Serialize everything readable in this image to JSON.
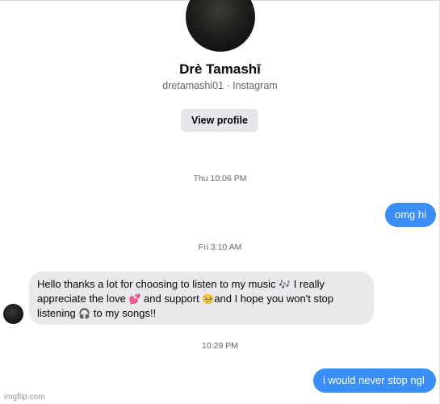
{
  "profile": {
    "name": "Drè Tamashī",
    "handle_line": "dretamashi01 · Instagram",
    "view_profile_label": "View profile"
  },
  "timestamps": [
    "Thu 10:06 PM",
    "Fri 3:10 AM",
    "10:29 PM"
  ],
  "messages": [
    {
      "direction": "outgoing",
      "text": "omg hi"
    },
    {
      "direction": "incoming",
      "parts": {
        "p1": "Hello thanks a lot for choosing to listen to my music ",
        "e1": "🎶",
        "p2": " I really appreciate the love ",
        "e2": "💕",
        "p3": " and support ",
        "e3": "🥺",
        "p4": "and I hope you won't stop listening ",
        "e4": "🎧",
        "p5": " to my songs!!"
      }
    },
    {
      "direction": "outgoing",
      "text": "i would never stop ngl"
    }
  ],
  "icons": {
    "notes": "musical-notes-emoji",
    "heart": "two-hearts-emoji",
    "face": "pleading-face-emoji",
    "headphones": "headphones-emoji"
  },
  "watermark": "imgflip.com",
  "colors": {
    "outgoing_bubble": "#3a8ef6",
    "incoming_bubble": "#e9e9eb",
    "button_bg": "#e4e6eb",
    "muted_text": "#65676b"
  }
}
